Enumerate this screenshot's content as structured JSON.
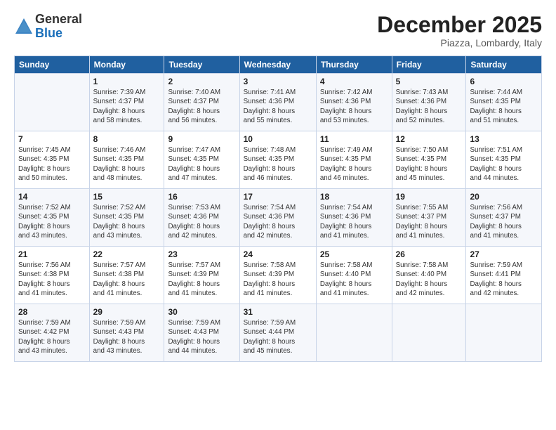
{
  "header": {
    "logo_general": "General",
    "logo_blue": "Blue",
    "title": "December 2025",
    "subtitle": "Piazza, Lombardy, Italy"
  },
  "days_of_week": [
    "Sunday",
    "Monday",
    "Tuesday",
    "Wednesday",
    "Thursday",
    "Friday",
    "Saturday"
  ],
  "weeks": [
    [
      {
        "day": "",
        "info": ""
      },
      {
        "day": "1",
        "info": "Sunrise: 7:39 AM\nSunset: 4:37 PM\nDaylight: 8 hours\nand 58 minutes."
      },
      {
        "day": "2",
        "info": "Sunrise: 7:40 AM\nSunset: 4:37 PM\nDaylight: 8 hours\nand 56 minutes."
      },
      {
        "day": "3",
        "info": "Sunrise: 7:41 AM\nSunset: 4:36 PM\nDaylight: 8 hours\nand 55 minutes."
      },
      {
        "day": "4",
        "info": "Sunrise: 7:42 AM\nSunset: 4:36 PM\nDaylight: 8 hours\nand 53 minutes."
      },
      {
        "day": "5",
        "info": "Sunrise: 7:43 AM\nSunset: 4:36 PM\nDaylight: 8 hours\nand 52 minutes."
      },
      {
        "day": "6",
        "info": "Sunrise: 7:44 AM\nSunset: 4:35 PM\nDaylight: 8 hours\nand 51 minutes."
      }
    ],
    [
      {
        "day": "7",
        "info": "Sunrise: 7:45 AM\nSunset: 4:35 PM\nDaylight: 8 hours\nand 50 minutes."
      },
      {
        "day": "8",
        "info": "Sunrise: 7:46 AM\nSunset: 4:35 PM\nDaylight: 8 hours\nand 48 minutes."
      },
      {
        "day": "9",
        "info": "Sunrise: 7:47 AM\nSunset: 4:35 PM\nDaylight: 8 hours\nand 47 minutes."
      },
      {
        "day": "10",
        "info": "Sunrise: 7:48 AM\nSunset: 4:35 PM\nDaylight: 8 hours\nand 46 minutes."
      },
      {
        "day": "11",
        "info": "Sunrise: 7:49 AM\nSunset: 4:35 PM\nDaylight: 8 hours\nand 46 minutes."
      },
      {
        "day": "12",
        "info": "Sunrise: 7:50 AM\nSunset: 4:35 PM\nDaylight: 8 hours\nand 45 minutes."
      },
      {
        "day": "13",
        "info": "Sunrise: 7:51 AM\nSunset: 4:35 PM\nDaylight: 8 hours\nand 44 minutes."
      }
    ],
    [
      {
        "day": "14",
        "info": "Sunrise: 7:52 AM\nSunset: 4:35 PM\nDaylight: 8 hours\nand 43 minutes."
      },
      {
        "day": "15",
        "info": "Sunrise: 7:52 AM\nSunset: 4:35 PM\nDaylight: 8 hours\nand 43 minutes."
      },
      {
        "day": "16",
        "info": "Sunrise: 7:53 AM\nSunset: 4:36 PM\nDaylight: 8 hours\nand 42 minutes."
      },
      {
        "day": "17",
        "info": "Sunrise: 7:54 AM\nSunset: 4:36 PM\nDaylight: 8 hours\nand 42 minutes."
      },
      {
        "day": "18",
        "info": "Sunrise: 7:54 AM\nSunset: 4:36 PM\nDaylight: 8 hours\nand 41 minutes."
      },
      {
        "day": "19",
        "info": "Sunrise: 7:55 AM\nSunset: 4:37 PM\nDaylight: 8 hours\nand 41 minutes."
      },
      {
        "day": "20",
        "info": "Sunrise: 7:56 AM\nSunset: 4:37 PM\nDaylight: 8 hours\nand 41 minutes."
      }
    ],
    [
      {
        "day": "21",
        "info": "Sunrise: 7:56 AM\nSunset: 4:38 PM\nDaylight: 8 hours\nand 41 minutes."
      },
      {
        "day": "22",
        "info": "Sunrise: 7:57 AM\nSunset: 4:38 PM\nDaylight: 8 hours\nand 41 minutes."
      },
      {
        "day": "23",
        "info": "Sunrise: 7:57 AM\nSunset: 4:39 PM\nDaylight: 8 hours\nand 41 minutes."
      },
      {
        "day": "24",
        "info": "Sunrise: 7:58 AM\nSunset: 4:39 PM\nDaylight: 8 hours\nand 41 minutes."
      },
      {
        "day": "25",
        "info": "Sunrise: 7:58 AM\nSunset: 4:40 PM\nDaylight: 8 hours\nand 41 minutes."
      },
      {
        "day": "26",
        "info": "Sunrise: 7:58 AM\nSunset: 4:40 PM\nDaylight: 8 hours\nand 42 minutes."
      },
      {
        "day": "27",
        "info": "Sunrise: 7:59 AM\nSunset: 4:41 PM\nDaylight: 8 hours\nand 42 minutes."
      }
    ],
    [
      {
        "day": "28",
        "info": "Sunrise: 7:59 AM\nSunset: 4:42 PM\nDaylight: 8 hours\nand 43 minutes."
      },
      {
        "day": "29",
        "info": "Sunrise: 7:59 AM\nSunset: 4:43 PM\nDaylight: 8 hours\nand 43 minutes."
      },
      {
        "day": "30",
        "info": "Sunrise: 7:59 AM\nSunset: 4:43 PM\nDaylight: 8 hours\nand 44 minutes."
      },
      {
        "day": "31",
        "info": "Sunrise: 7:59 AM\nSunset: 4:44 PM\nDaylight: 8 hours\nand 45 minutes."
      },
      {
        "day": "",
        "info": ""
      },
      {
        "day": "",
        "info": ""
      },
      {
        "day": "",
        "info": ""
      }
    ]
  ]
}
